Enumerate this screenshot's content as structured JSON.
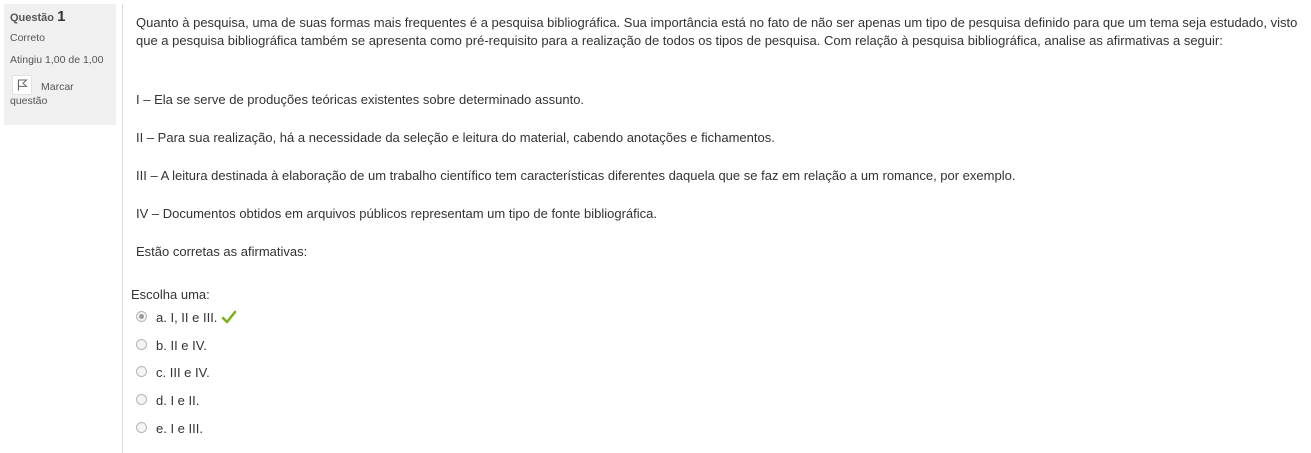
{
  "info": {
    "question_label": "Questão",
    "question_number": "1",
    "state": "Correto",
    "grade": "Atingiu 1,00 de 1,00",
    "flag_label_line1": "Marcar",
    "flag_label_line2": "questão"
  },
  "question": {
    "intro": "Quanto à pesquisa, uma de suas formas mais frequentes é a pesquisa bibliográfica. Sua importância está no fato de não ser apenas um tipo de pesquisa definido para que um tema seja estudado, visto que a pesquisa bibliográfica também se apresenta como pré-requisito para a realização de todos os tipos de pesquisa. Com relação à pesquisa bibliográfica, analise as afirmativas a seguir:",
    "statements": [
      "I – Ela se serve de produções teóricas existentes sobre determinado assunto.",
      "II – Para sua realização, há a necessidade da seleção e leitura do material, cabendo anotações e fichamentos.",
      "III – A leitura destinada à elaboração de um trabalho científico tem características diferentes daquela que se faz em relação a um romance, por exemplo.",
      "IV – Documentos obtidos em arquivos públicos representam um tipo de fonte bibliográfica."
    ],
    "prompt": "Estão corretas as afirmativas:"
  },
  "answer": {
    "choose_label": "Escolha uma:",
    "options": [
      {
        "label": "a. I, II e III.",
        "selected": true,
        "correct_icon": "checkmark-icon"
      },
      {
        "label": "b. II e IV.",
        "selected": false
      },
      {
        "label": "c. III e IV.",
        "selected": false
      },
      {
        "label": "d. I e II.",
        "selected": false
      },
      {
        "label": "e. I e III.",
        "selected": false
      }
    ]
  },
  "colors": {
    "info_background": "#f0f0f0",
    "text": "#333333",
    "correct_check": "#7ab317"
  }
}
